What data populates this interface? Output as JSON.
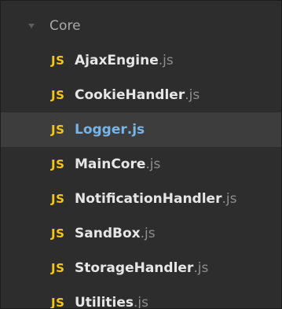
{
  "tree": {
    "folder": {
      "label": "Core",
      "icon": "chevron-down-icon",
      "expanded": true
    },
    "files": [
      {
        "icon_label": "JS",
        "name": "AjaxEngine",
        "ext": ".js",
        "selected": false
      },
      {
        "icon_label": "JS",
        "name": "CookieHandler",
        "ext": ".js",
        "selected": false
      },
      {
        "icon_label": "JS",
        "name": "Logger",
        "ext": ".js",
        "selected": true
      },
      {
        "icon_label": "JS",
        "name": "MainCore",
        "ext": ".js",
        "selected": false
      },
      {
        "icon_label": "JS",
        "name": "NotificationHandler",
        "ext": ".js",
        "selected": false
      },
      {
        "icon_label": "JS",
        "name": "SandBox",
        "ext": ".js",
        "selected": false
      },
      {
        "icon_label": "JS",
        "name": "StorageHandler",
        "ext": ".js",
        "selected": false
      },
      {
        "icon_label": "JS",
        "name": "Utilities",
        "ext": ".js",
        "selected": false
      }
    ]
  },
  "colors": {
    "background": "#2d2d2d",
    "selected_row": "#3d3d3d",
    "js_icon": "#f5c518",
    "selected_text": "#78b4e6",
    "file_text": "#e6e6e6",
    "ext_text": "#8e8e8e"
  }
}
